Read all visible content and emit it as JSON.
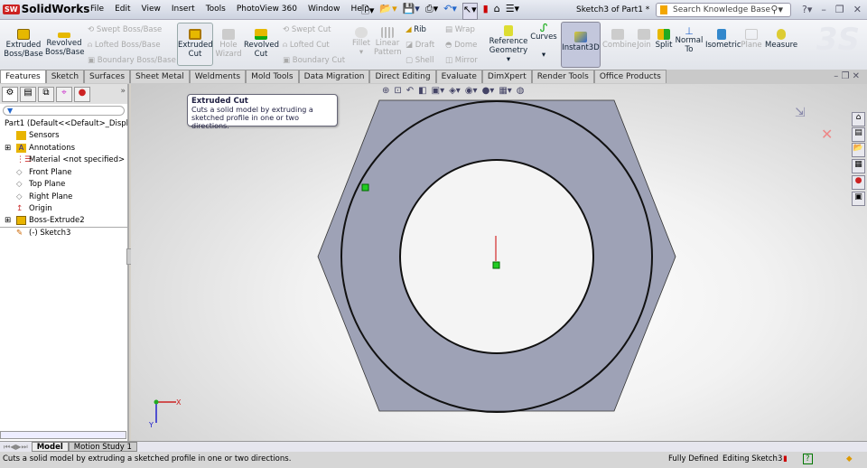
{
  "app": {
    "name": "SolidWorks",
    "logo_text": "SW",
    "doc_title": "Sketch3 of Part1 *"
  },
  "menu": [
    "File",
    "Edit",
    "View",
    "Insert",
    "Tools",
    "PhotoView 360",
    "Window",
    "Help"
  ],
  "search": {
    "placeholder": "Search Knowledge Base"
  },
  "ribbon": {
    "extruded_boss": "Extruded Boss/Base",
    "revolved_boss": "Revolved Boss/Base",
    "swept_boss": "Swept Boss/Base",
    "lofted_boss": "Lofted Boss/Base",
    "boundary_boss": "Boundary Boss/Base",
    "extruded_cut": "Extruded Cut",
    "hole_wizard": "Hole Wizard",
    "revolved_cut": "Revolved Cut",
    "swept_cut": "Swept Cut",
    "lofted_cut": "Lofted Cut",
    "boundary_cut": "Boundary Cut",
    "fillet": "Fillet",
    "linear_pattern": "Linear Pattern",
    "rib": "Rib",
    "draft": "Draft",
    "shell": "Shell",
    "wrap": "Wrap",
    "dome": "Dome",
    "mirror": "Mirror",
    "reference_geometry": "Reference Geometry",
    "curves": "Curves",
    "instant3d": "Instant3D",
    "combine": "Combine",
    "join": "Join",
    "split": "Split",
    "normal_to": "Normal To",
    "isometric": "Isometric",
    "plane": "Plane",
    "measure": "Measure"
  },
  "tabs": [
    "Features",
    "Sketch",
    "Surfaces",
    "Sheet Metal",
    "Weldments",
    "Mold Tools",
    "Data Migration",
    "Direct Editing",
    "Evaluate",
    "DimXpert",
    "Render Tools",
    "Office Products"
  ],
  "active_tab": "Features",
  "tooltip": {
    "title": "Extruded Cut",
    "body": "Cuts a solid model by extruding a sketched profile in one or two directions."
  },
  "tree": [
    {
      "label": "Part1  (Default<<Default>_Displa",
      "color": "#c8a000"
    },
    {
      "label": "Sensors",
      "color": "#e8b400"
    },
    {
      "label": "Annotations",
      "color": "#e8b400"
    },
    {
      "label": "Material <not specified>",
      "color": "#c33"
    },
    {
      "label": "Front Plane",
      "color": "#888"
    },
    {
      "label": "Top Plane",
      "color": "#888"
    },
    {
      "label": "Right Plane",
      "color": "#888"
    },
    {
      "label": "Origin",
      "color": "#c33"
    },
    {
      "label": "Boss-Extrude2",
      "color": "#e8b400"
    },
    {
      "label": "(-) Sketch3",
      "color": "#c60"
    }
  ],
  "bottom_tabs": [
    "Model",
    "Motion Study 1"
  ],
  "status": {
    "message": "Cuts a solid model by extruding a sketched profile in one or two directions.",
    "state": "Fully Defined",
    "editing": "Editing Sketch3"
  },
  "triad": {
    "x": "X",
    "y": "Y"
  },
  "colors": {
    "model_face": "#9ea2b6",
    "accent": "#2a5db0"
  }
}
